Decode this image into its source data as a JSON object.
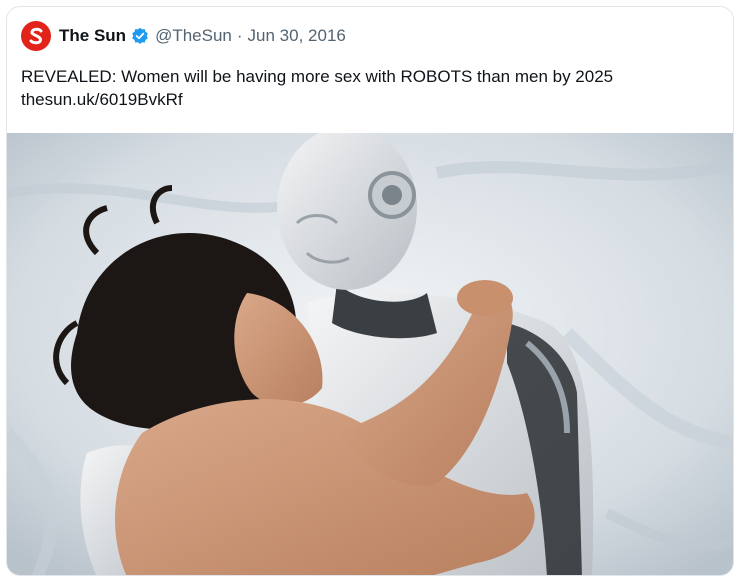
{
  "tweet": {
    "author_name": "The Sun",
    "handle": "@TheSun",
    "separator": "·",
    "date": "Jun 30, 2016",
    "text": "REVEALED: Women will be having more sex with ROBOTS than men by 2025",
    "link": "thesun.uk/6019BvkRf"
  },
  "icons": {
    "logo": "the-sun-logo",
    "verified": "verified-badge-icon"
  },
  "colors": {
    "brand_red": "#e2231a",
    "verified_blue": "#1d9bf0"
  }
}
